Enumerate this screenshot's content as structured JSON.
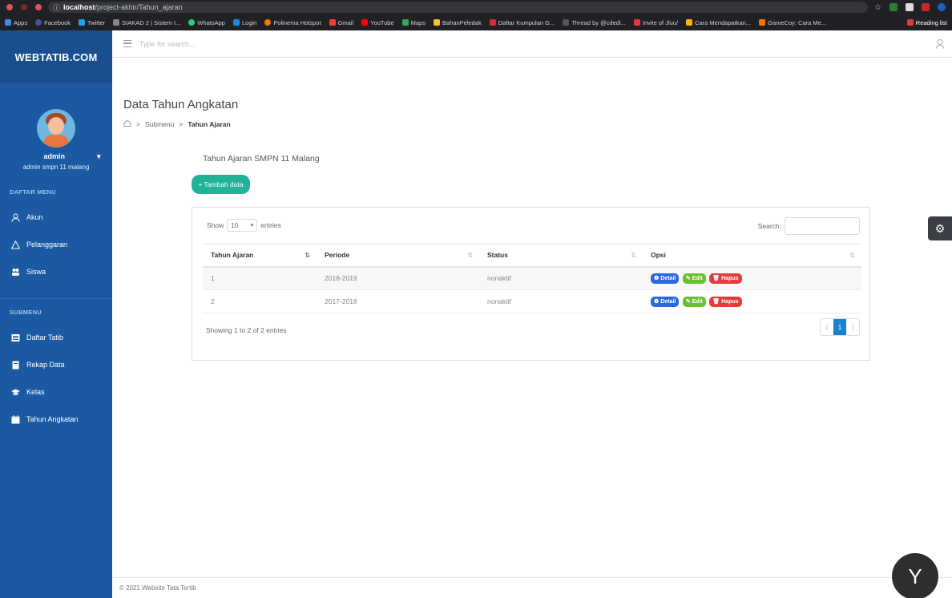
{
  "browser": {
    "url_host": "localhost",
    "url_path": "/project-akhir/Tahun_ajaran",
    "bookmarks": [
      "Apps",
      "Facebook",
      "Twitter",
      "SIAKAD 2 | Sistem I...",
      "WhatsApp",
      "Login",
      "Polinema Hotspot",
      "Gmail",
      "YouTube",
      "Maps",
      "BahanPeledak",
      "Daftar Kumpulan G...",
      "Thread by @cdedi...",
      "Invite of Jluu/",
      "Cara Mendapatkan...",
      "GameCoy: Cara Me..."
    ],
    "reading_list": "Reading list"
  },
  "brand": "WEBTATIB.COM",
  "profile": {
    "name": "admin",
    "subtitle": "admin smpn 11 malang"
  },
  "sidebar": {
    "section1": "DAFTAR MENU",
    "items1": [
      {
        "label": "Akun",
        "icon": "user-icon"
      },
      {
        "label": "Pelanggaran",
        "icon": "warning-icon"
      },
      {
        "label": "Siswa",
        "icon": "users-icon"
      }
    ],
    "section2": "SUBMENU",
    "items2": [
      {
        "label": "Daftar Tatib",
        "icon": "list-icon"
      },
      {
        "label": "Rekap Data",
        "icon": "file-icon"
      },
      {
        "label": "Kelas",
        "icon": "graduation-icon"
      },
      {
        "label": "Tahun Angkatan",
        "icon": "calendar-icon"
      }
    ]
  },
  "topbar": {
    "search_placeholder": "Type for search..."
  },
  "page": {
    "title": "Data Tahun Angkatan",
    "breadcrumb": [
      "Submenu",
      "Tahun Ajaran"
    ],
    "section_title": "Tahun Ajaran SMPN 11 Malang",
    "add_button": "Tambah data"
  },
  "table": {
    "show_label": "Show",
    "entries_value": "10",
    "entries_label": "entries",
    "search_label": "Search:",
    "columns": [
      "Tahun Ajaran",
      "Periode",
      "Status",
      "Opsi"
    ],
    "rows": [
      {
        "no": "1",
        "periode": "2018-2019",
        "status": "nonaktif"
      },
      {
        "no": "2",
        "periode": "2017-2018",
        "status": "nonaktif"
      }
    ],
    "actions": {
      "detail": "Detail",
      "edit": "Edit",
      "hapus": "Hapus"
    },
    "info": "Showing 1 to 2 of 2 entries",
    "pagination": {
      "prev": "(",
      "current": "1",
      "next": ")"
    }
  },
  "footer": "© 2021 Website Tata Tertib",
  "colors": {
    "sidebar": "#1b5aa3",
    "accent": "#21b39a",
    "detail": "#2a67e0",
    "edit": "#6ac02e",
    "hapus": "#e43c3c"
  }
}
